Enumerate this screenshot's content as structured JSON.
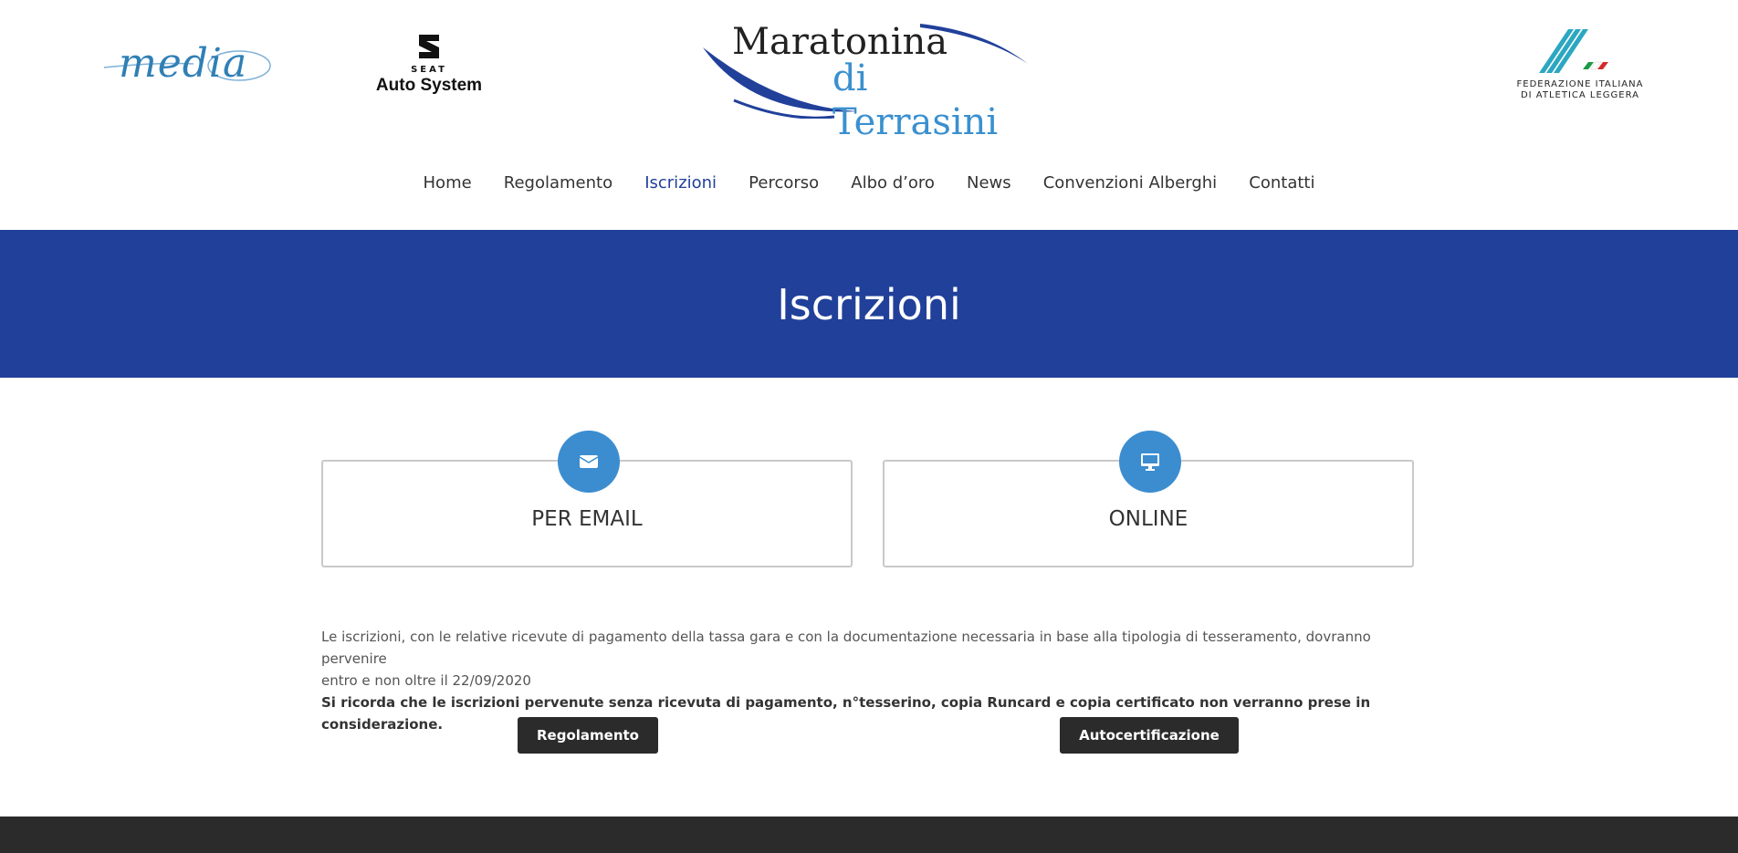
{
  "header": {
    "logos": {
      "media": {
        "text": "media",
        "icon": "media-logo"
      },
      "seat": {
        "brand": "SEAT",
        "name": "Auto System",
        "icon": "seat-logo"
      },
      "main": {
        "line1": "Maratonina",
        "line2": "di Terrasini",
        "icon": "maratonina-logo"
      },
      "fidal": {
        "line1": "FEDERAZIONE ITALIANA",
        "line2": "DI ATLETICA LEGGERA",
        "icon": "fidal-logo"
      }
    },
    "nav": [
      {
        "label": "Home"
      },
      {
        "label": "Regolamento"
      },
      {
        "label": "Iscrizioni",
        "active": true
      },
      {
        "label": "Percorso"
      },
      {
        "label": "Albo d’oro"
      },
      {
        "label": "News"
      },
      {
        "label": "Convenzioni Alberghi"
      },
      {
        "label": "Contatti"
      }
    ]
  },
  "banner": {
    "title": "Iscrizioni",
    "color": "#21409a"
  },
  "options": [
    {
      "title": "PER EMAIL",
      "icon": "envelope-icon"
    },
    {
      "title": "ONLINE",
      "icon": "monitor-icon"
    }
  ],
  "content": {
    "paragraph1_line1": "Le iscrizioni, con le relative ricevute di pagamento della tassa gara e con la documentazione necessaria in base alla tipologia di tesseramento, dovranno pervenire",
    "paragraph1_line2": "entro e non oltre il 22/09/2020",
    "paragraph2": "Si ricorda che le iscrizioni pervenute senza ricevuta di pagamento, n°tesserino, copia Runcard e copia certificato non verranno prese in considerazione."
  },
  "buttons": {
    "regolamento": "Regolamento",
    "autocertificazione": "Autocertificazione"
  },
  "colors": {
    "accent": "#21409a",
    "icon_circle": "#3c8dd0",
    "button": "#2b2b2b",
    "footer": "#2b2b2b"
  }
}
